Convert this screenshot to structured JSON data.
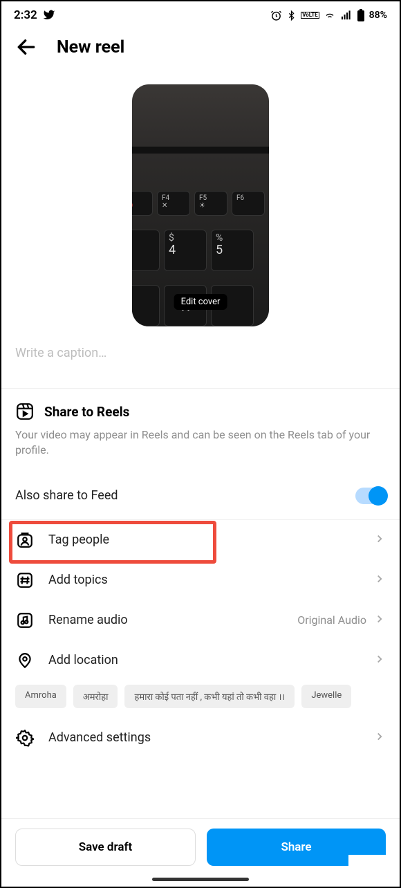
{
  "status": {
    "time": "2:32",
    "battery": "88%",
    "lte_badge": "VoLTE"
  },
  "header": {
    "title": "New reel"
  },
  "cover": {
    "edit_label": "Edit cover"
  },
  "caption": {
    "placeholder": "Write a caption…"
  },
  "share_reels": {
    "title": "Share to Reels",
    "description": "Your video may appear in Reels and can be seen on the Reels tab of your profile."
  },
  "feed": {
    "label": "Also share to Feed",
    "enabled": true
  },
  "options": {
    "tag_people": {
      "label": "Tag people"
    },
    "add_topics": {
      "label": "Add topics"
    },
    "rename_audio": {
      "label": "Rename audio",
      "value": "Original Audio"
    },
    "add_location": {
      "label": "Add location"
    },
    "advanced": {
      "label": "Advanced settings"
    }
  },
  "location_suggestions": [
    "Amroha",
    "अमरोहा",
    "हमारा कोई पता नहीं , कभी यहां तो कभी वहा ।।",
    "Jewelle"
  ],
  "buttons": {
    "draft": "Save draft",
    "share": "Share"
  }
}
